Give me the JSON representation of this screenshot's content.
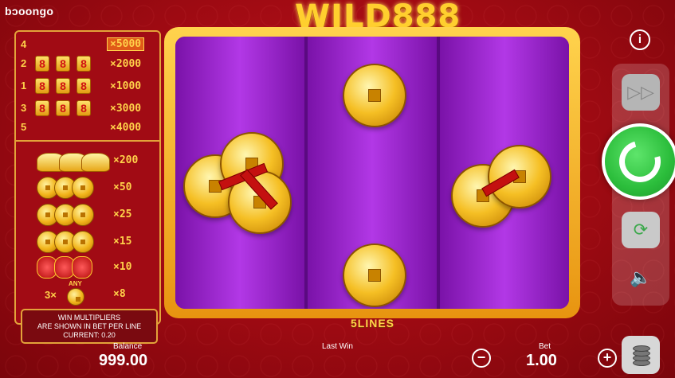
{
  "brand": {
    "logo": "bɔoongo"
  },
  "game": {
    "title": "WILD888",
    "lines_label": "5LINES"
  },
  "paytable": {
    "line_rows": [
      {
        "line": "4",
        "multiplier": "×5000",
        "highlight": true
      },
      {
        "line": "2",
        "multiplier": "×2000"
      },
      {
        "line": "1",
        "multiplier": "×1000"
      },
      {
        "line": "3",
        "multiplier": "×3000"
      },
      {
        "line": "5",
        "multiplier": "×4000"
      }
    ],
    "symbols": [
      {
        "symbol": "gold-ingot",
        "multiplier": "×200"
      },
      {
        "symbol": "coin-red-triangle",
        "multiplier": "×50"
      },
      {
        "symbol": "coin-stack",
        "multiplier": "×25"
      },
      {
        "symbol": "single-coin",
        "multiplier": "×15"
      },
      {
        "symbol": "lantern",
        "multiplier": "×10"
      },
      {
        "symbol": "any-coin",
        "prefix": "3×",
        "any_label": "ANY",
        "multiplier": "×8"
      }
    ],
    "info": {
      "line1": "WIN MULTIPLIERS",
      "line2": "ARE SHOWN IN BET PER LINE",
      "line3": "CURRENT: 0.20"
    }
  },
  "controls": {
    "info_icon": "i",
    "turbo_icon": "fast-forward-icon",
    "spin_icon": "spin-arrow-icon",
    "autoplay_icon": "autoplay-icon",
    "sound_icon": "speaker-icon",
    "coins_icon": "coin-stack-icon"
  },
  "bottom": {
    "balance_label": "Balance",
    "balance_value": "999.00",
    "lastwin_label": "Last Win",
    "bet_label": "Bet",
    "bet_value": "1.00",
    "minus": "−",
    "plus": "+"
  },
  "colors": {
    "spin": "#2bbd3b",
    "gold": "#ffd24a",
    "reel": "#9b2ed0",
    "background": "#a80d15"
  }
}
